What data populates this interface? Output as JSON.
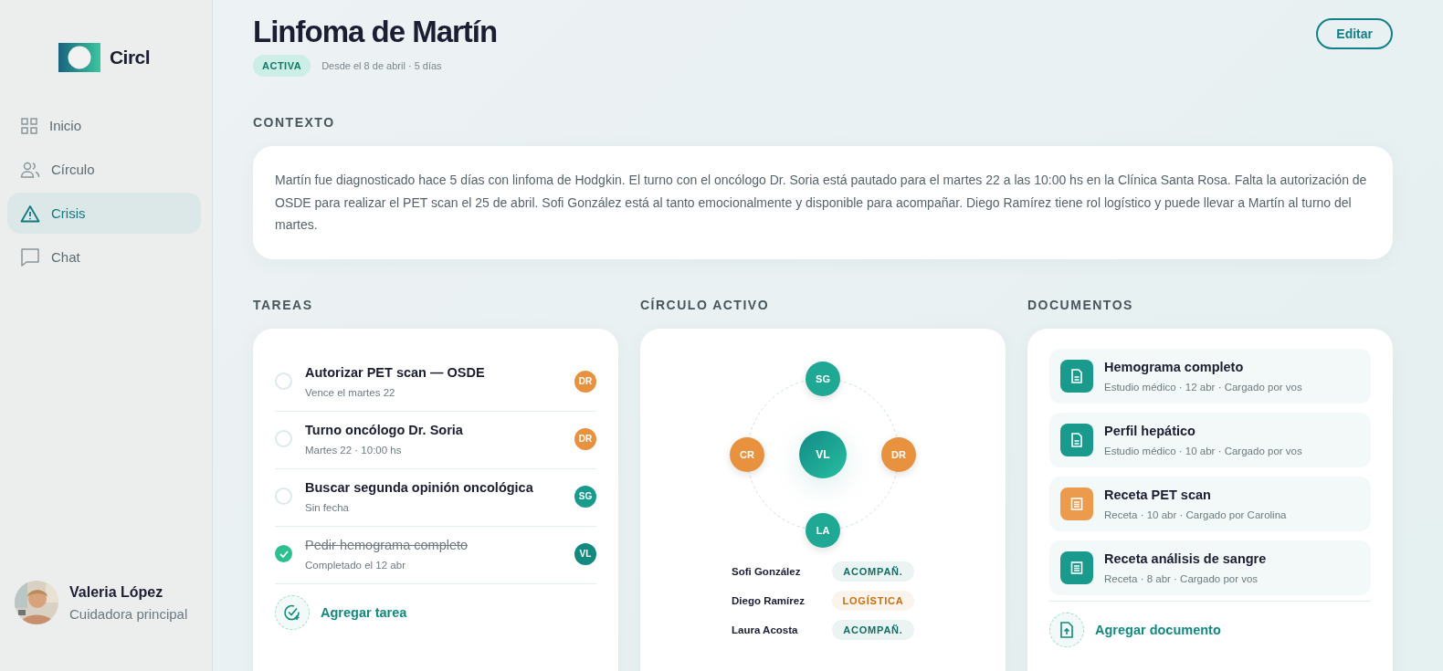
{
  "sidebar": {
    "logo": "Circl",
    "items": [
      {
        "label": "Inicio",
        "selected": false
      },
      {
        "label": "Círculo",
        "selected": false
      },
      {
        "label": "Crisis",
        "selected": true
      },
      {
        "label": "Chat",
        "selected": false
      }
    ],
    "user": {
      "name": "Valeria López",
      "role": "Cuidadora principal"
    }
  },
  "header": {
    "title": "Linfoma de Martín",
    "status": "ACTIVA",
    "since": "Desde el 8 de abril · 5 días",
    "edit_button": "Editar"
  },
  "context": {
    "heading": "CONTEXTO",
    "text": "Martín fue diagnosticado hace 5 días con linfoma de Hodgkin. El turno con el oncólogo Dr. Soria está pautado para el martes 22 a las 10:00 hs en la Clínica Santa Rosa. Falta la autorización de OSDE para realizar el PET scan el 25 de abril. Sofi González está al tanto emocionalmente y disponible para acompañar. Diego Ramírez tiene rol logístico y puede llevar a Martín al turno del martes."
  },
  "tasks": {
    "heading": "TAREAS",
    "items": [
      {
        "title": "Autorizar PET scan — OSDE",
        "meta": "Vence el martes 22",
        "checked": false,
        "assignee": "DR",
        "color": "#e8913f"
      },
      {
        "title": "Turno oncólogo Dr. Soria",
        "meta": "Martes 22 · 10:00 hs",
        "checked": false,
        "assignee": "DR",
        "color": "#e8913f"
      },
      {
        "title": "Buscar segunda opinión oncológica",
        "meta": "Sin fecha",
        "checked": false,
        "assignee": "SG",
        "color": "#179b8c"
      },
      {
        "title": "Pedir hemograma completo",
        "meta": "Completado el 12 abr",
        "checked": true,
        "assignee": "VL",
        "color": "#138a80"
      }
    ],
    "add_label": "Agregar tarea"
  },
  "circle": {
    "heading": "CÍRCULO ACTIVO",
    "center": "VL",
    "nodes": [
      {
        "initials": "SG",
        "color": "#1fa893"
      },
      {
        "initials": "CR",
        "color": "#e8913f"
      },
      {
        "initials": "DR",
        "color": "#e8913f"
      },
      {
        "initials": "LA",
        "color": "#1fa893"
      }
    ],
    "members": [
      {
        "name": "Sofi González",
        "role": "ACOMPAÑ.",
        "color": "#0f6e62"
      },
      {
        "name": "Diego Ramírez",
        "role": "LOGÍSTICA",
        "color": "#c96f12"
      },
      {
        "name": "Laura Acosta",
        "role": "ACOMPAÑ.",
        "color": "#0f6e62"
      }
    ]
  },
  "documents": {
    "heading": "DOCUMENTOS",
    "items": [
      {
        "title": "Hemograma completo",
        "meta": "Estudio médico · 12 abr · Cargado por vos",
        "kind": "study",
        "color": "#1a9a8c"
      },
      {
        "title": "Perfil hepático",
        "meta": "Estudio médico · 10 abr · Cargado por vos",
        "kind": "study",
        "color": "#1a9a8c"
      },
      {
        "title": "Receta PET scan",
        "meta": "Receta · 10 abr · Cargado por Carolina",
        "kind": "prescription",
        "color": "#ec9a4c"
      },
      {
        "title": "Receta análisis de sangre",
        "meta": "Receta · 8 abr · Cargado por vos",
        "kind": "prescription",
        "color": "#1a9a8c"
      }
    ],
    "add_label": "Agregar documento"
  }
}
